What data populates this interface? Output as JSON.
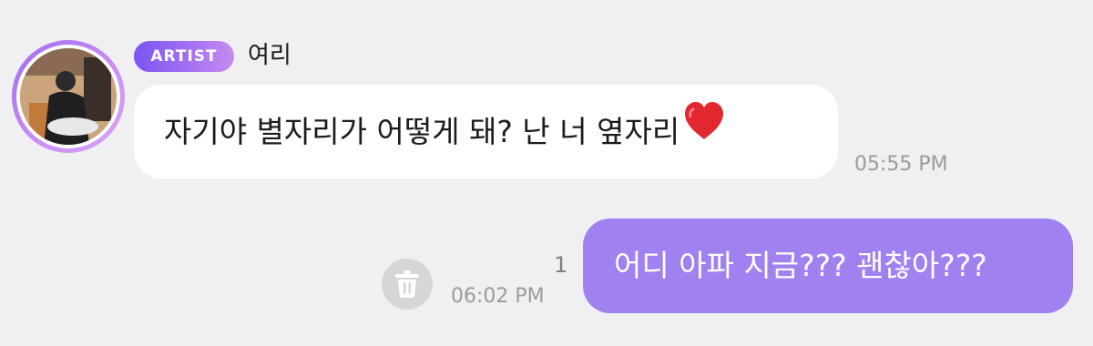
{
  "header": {
    "badge_label": "ARTIST",
    "sender_name": "여리"
  },
  "messages": [
    {
      "direction": "incoming",
      "text": "자기야 별자리가 어떻게 돼? 난 너 옆자리",
      "emoji": "red-heart",
      "time": "05:55 PM"
    },
    {
      "direction": "outgoing",
      "text": "어디 아파 지금??? 괜찮아???",
      "unread_count": "1",
      "time": "06:02 PM"
    }
  ],
  "icons": {
    "avatar": "profile-photo",
    "delete": "trash-icon",
    "heart": "heart-icon"
  },
  "colors": {
    "background": "#f0f0f2",
    "incoming_bubble": "#ffffff",
    "outgoing_bubble": "#9f81f0",
    "badge_start": "#7b55f2",
    "badge_end": "#c58cf2",
    "avatar_ring": "#b57ef3",
    "heart": "#e0282e",
    "timestamp": "#9b9b9f"
  }
}
